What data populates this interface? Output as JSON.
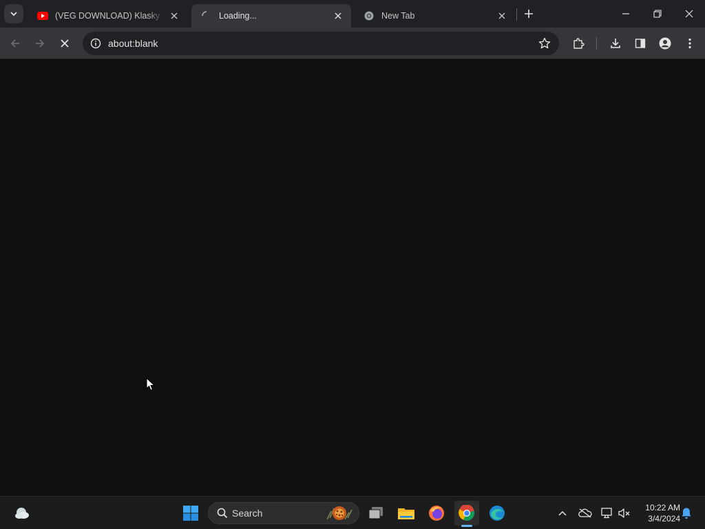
{
  "browser": {
    "tabs": [
      {
        "title": "(VEG DOWNLOAD) Klasky Csupo",
        "favicon": "youtube-icon",
        "state": "inactive"
      },
      {
        "title": "Loading...",
        "favicon": "spinner-icon",
        "state": "active"
      },
      {
        "title": "New Tab",
        "favicon": "chrome-icon",
        "state": "inactive"
      }
    ],
    "address_bar": {
      "url": "about:blank"
    },
    "toolbar_icons": [
      "back-icon",
      "forward-icon",
      "stop-icon",
      "info-icon",
      "star-icon",
      "extensions-icon",
      "download-icon",
      "side-panel-icon",
      "profile-icon",
      "menu-icon"
    ],
    "window_controls": [
      "minimize-icon",
      "restore-icon",
      "close-icon"
    ]
  },
  "taskbar": {
    "search_placeholder": "Search",
    "pinned_apps": [
      "weather-icon",
      "start-icon",
      "task-view-icon",
      "file-explorer-icon",
      "firefox-icon",
      "chrome-icon",
      "edge-icon"
    ],
    "active_app": "chrome-icon",
    "tray_icons": [
      "chevron-up-icon",
      "onedrive-icon",
      "network-icon",
      "volume-muted-icon",
      "notification-bell-icon"
    ],
    "clock": {
      "time": "10:22 AM",
      "date": "3/4/2024"
    }
  },
  "colors": {
    "tabstrip_bg": "#202124",
    "toolbar_bg": "#35363a",
    "content_bg": "#0f0f0f",
    "taskbar_bg": "#1c1c1c",
    "accent": "#6cb8f6"
  }
}
